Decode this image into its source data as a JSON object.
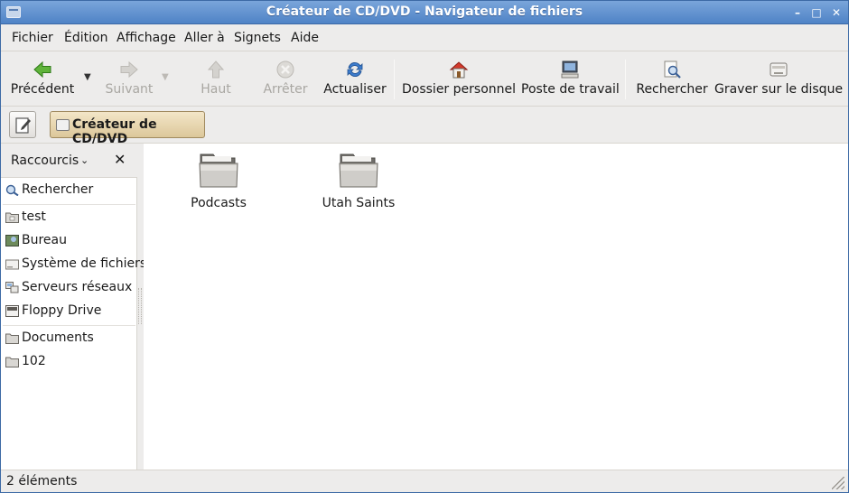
{
  "window": {
    "title": "Créateur de CD/DVD - Navigateur de fichiers"
  },
  "menubar": {
    "items": [
      {
        "label": "Fichier"
      },
      {
        "label": "Édition"
      },
      {
        "label": "Affichage"
      },
      {
        "label": "Aller à"
      },
      {
        "label": "Signets"
      },
      {
        "label": "Aide"
      }
    ]
  },
  "toolbar": {
    "back": "Précédent",
    "forward": "Suivant",
    "up": "Haut",
    "stop": "Arrêter",
    "reload": "Actualiser",
    "home": "Dossier personnel",
    "computer": "Poste de travail",
    "search": "Rechercher",
    "burn": "Graver sur le disque"
  },
  "location": {
    "current": "Créateur de CD/DVD"
  },
  "sidebar": {
    "selector": "Raccourcis",
    "items": [
      {
        "label": "Rechercher",
        "icon": "search-icon"
      },
      {
        "label": "test",
        "icon": "home-folder-icon"
      },
      {
        "label": "Bureau",
        "icon": "desktop-icon"
      },
      {
        "label": "Système de fichiers",
        "icon": "drive-icon"
      },
      {
        "label": "Serveurs réseaux",
        "icon": "network-icon"
      },
      {
        "label": "Floppy Drive",
        "icon": "floppy-icon"
      },
      {
        "label": "Documents",
        "icon": "folder-icon"
      },
      {
        "label": "102",
        "icon": "folder-icon"
      }
    ]
  },
  "files": [
    {
      "name": "Podcasts"
    },
    {
      "name": "Utah Saints"
    }
  ],
  "status": {
    "text": "2 éléments"
  }
}
